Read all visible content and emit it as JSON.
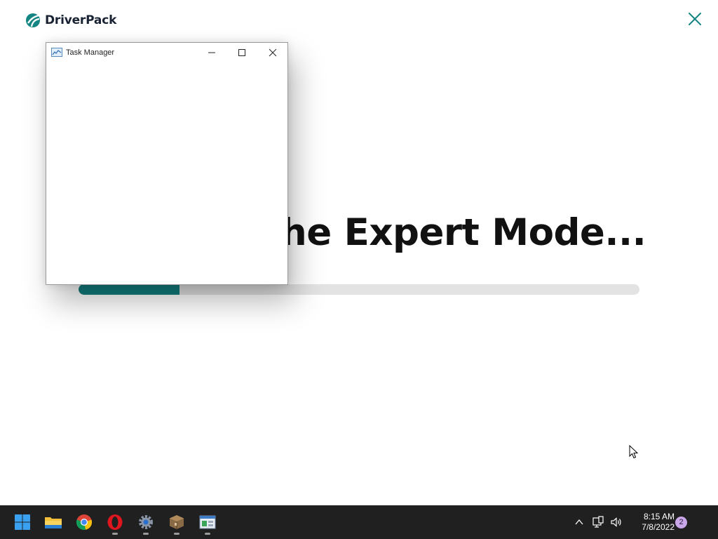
{
  "app": {
    "brand_name": "DriverPack",
    "headline": "he Expert Mode...",
    "progress_fraction": 0.18,
    "accent_color": "#127f7e",
    "close_icon": "close-icon"
  },
  "task_manager": {
    "title": "Task Manager",
    "icon": "task-manager-icon",
    "controls": [
      "minimize-icon",
      "maximize-icon",
      "close-icon"
    ]
  },
  "taskbar": {
    "apps": [
      {
        "name": "start-button",
        "icon": "windows-logo-icon"
      },
      {
        "name": "file-explorer",
        "icon": "folder-icon"
      },
      {
        "name": "chrome",
        "icon": "chrome-icon"
      },
      {
        "name": "opera",
        "icon": "opera-icon"
      },
      {
        "name": "settings",
        "icon": "gear-icon"
      },
      {
        "name": "package-app",
        "icon": "box-icon"
      },
      {
        "name": "task-manager",
        "icon": "task-manager-icon"
      }
    ],
    "tray": {
      "time": "8:15 AM",
      "date": "7/8/2022",
      "notification_count": "2"
    }
  }
}
